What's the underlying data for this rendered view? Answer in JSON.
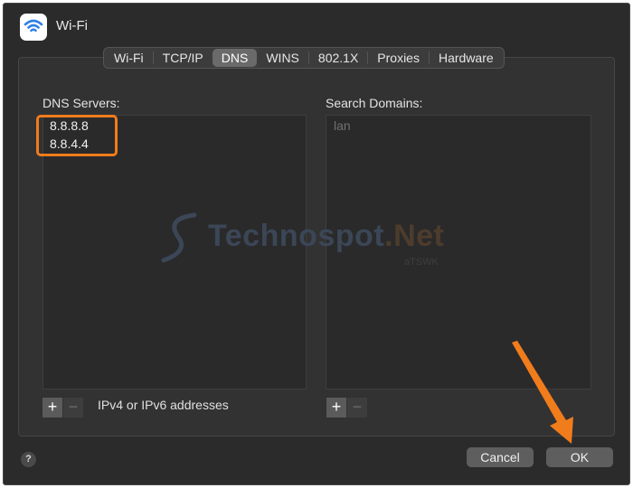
{
  "window": {
    "title": "Wi-Fi",
    "icon": "wifi-icon"
  },
  "tabs": [
    {
      "label": "Wi-Fi",
      "active": false
    },
    {
      "label": "TCP/IP",
      "active": false
    },
    {
      "label": "DNS",
      "active": true
    },
    {
      "label": "WINS",
      "active": false
    },
    {
      "label": "802.1X",
      "active": false
    },
    {
      "label": "Proxies",
      "active": false
    },
    {
      "label": "Hardware",
      "active": false
    }
  ],
  "dns": {
    "label": "DNS Servers:",
    "servers": [
      "8.8.8.8",
      "8.8.4.4"
    ],
    "add_label": "+",
    "remove_label": "−",
    "hint": "IPv4 or IPv6 addresses"
  },
  "search_domains": {
    "label": "Search Domains:",
    "items": [
      "lan"
    ],
    "add_label": "+",
    "remove_label": "−"
  },
  "footer": {
    "help_label": "?",
    "cancel_label": "Cancel",
    "ok_label": "OK"
  },
  "watermark": {
    "brand": "Technospot",
    "tld": ".Net",
    "sub": "aTSWK"
  },
  "colors": {
    "highlight": "#f07c1c",
    "window_bg": "#2b2b2c",
    "panel_bg": "#323233"
  }
}
